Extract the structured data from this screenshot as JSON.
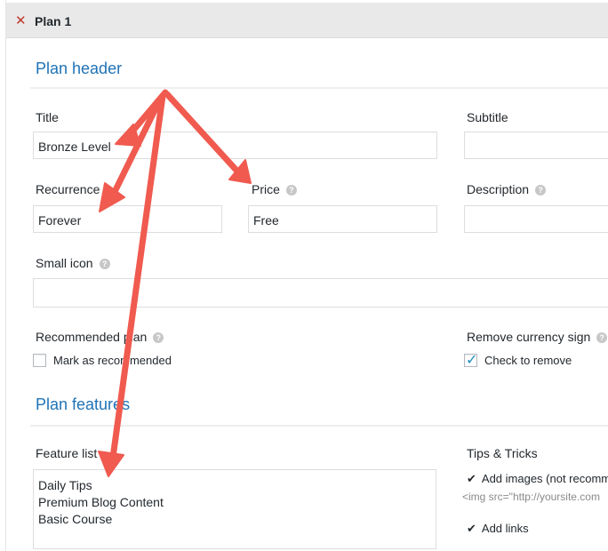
{
  "plan": {
    "close_symbol": "✕",
    "title": "Plan 1"
  },
  "plan_header": {
    "heading": "Plan header",
    "title_label": "Title",
    "title_value": "Bronze Level",
    "subtitle_label": "Subtitle",
    "subtitle_value": "",
    "recurrence_label": "Recurrence",
    "recurrence_value": "Forever",
    "price_label": "Price",
    "price_value": "Free",
    "description_label": "Description",
    "description_value": "",
    "small_icon_label": "Small icon",
    "small_icon_value": "",
    "recommended_label": "Recommended plan",
    "recommended_checkbox_label": "Mark as recommended",
    "recommended_checked": false,
    "remove_currency_label": "Remove currency sign",
    "remove_currency_checkbox_label": "Check to remove",
    "remove_currency_checked": true,
    "help_symbol": "?"
  },
  "plan_features": {
    "heading": "Plan features",
    "feature_list_label": "Feature list",
    "features": [
      "Daily Tips",
      "Premium Blog Content",
      "Basic Course"
    ],
    "tips_heading": "Tips & Tricks",
    "tips": [
      {
        "text": "Add images (not recomm",
        "code": "<img src=\"http://yoursite.com"
      },
      {
        "text": "Add links",
        "code": ""
      }
    ]
  },
  "colors": {
    "annotation_arrow": "#f05a4f",
    "section_heading": "#1f73b7",
    "close_icon": "#c0392b"
  }
}
